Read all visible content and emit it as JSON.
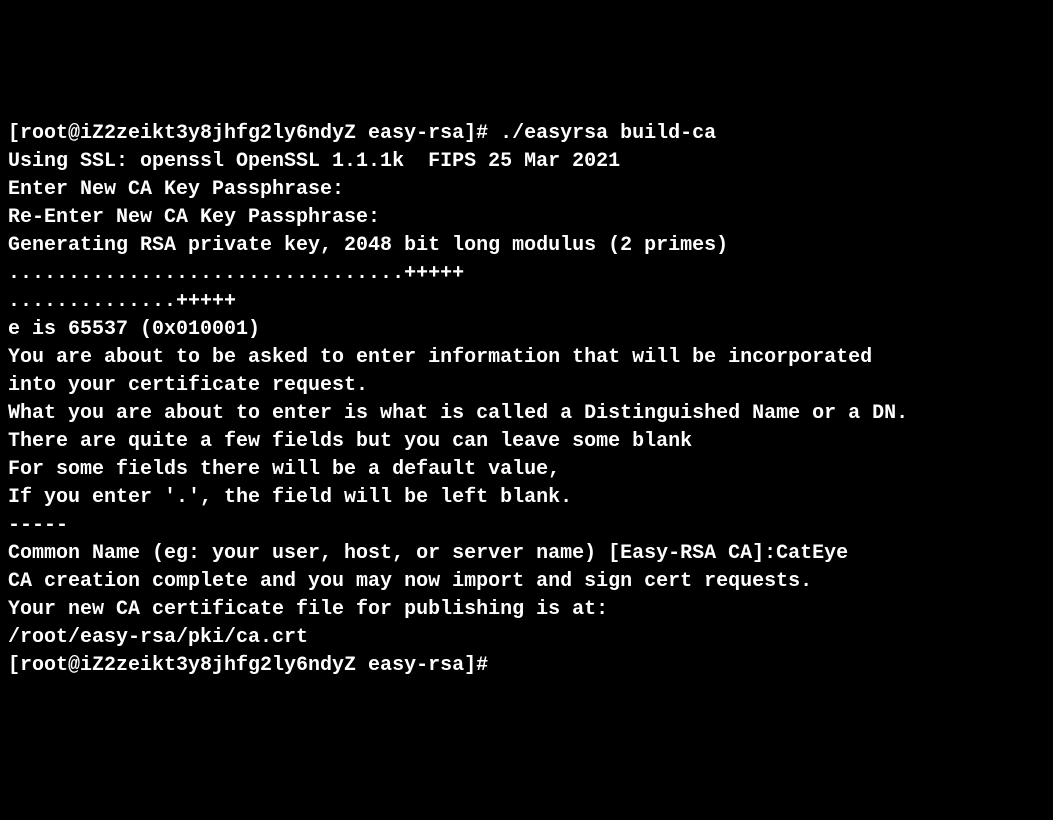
{
  "terminal": {
    "lines": [
      "[root@iZ2zeikt3y8jhfg2ly6ndyZ easy-rsa]# ./easyrsa build-ca",
      "Using SSL: openssl OpenSSL 1.1.1k  FIPS 25 Mar 2021",
      "",
      "Enter New CA Key Passphrase:",
      "Re-Enter New CA Key Passphrase:",
      "Generating RSA private key, 2048 bit long modulus (2 primes)",
      ".................................+++++",
      "..............+++++",
      "e is 65537 (0x010001)",
      "You are about to be asked to enter information that will be incorporated",
      "into your certificate request.",
      "What you are about to enter is what is called a Distinguished Name or a DN.",
      "There are quite a few fields but you can leave some blank",
      "For some fields there will be a default value,",
      "If you enter '.', the field will be left blank.",
      "-----",
      "Common Name (eg: your user, host, or server name) [Easy-RSA CA]:CatEye",
      "",
      "CA creation complete and you may now import and sign cert requests.",
      "Your new CA certificate file for publishing is at:",
      "/root/easy-rsa/pki/ca.crt",
      "",
      "",
      "[root@iZ2zeikt3y8jhfg2ly6ndyZ easy-rsa]#"
    ]
  }
}
